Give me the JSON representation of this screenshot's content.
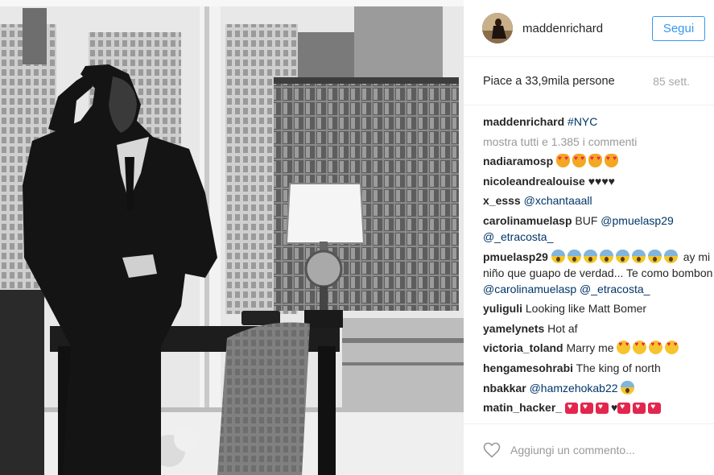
{
  "post": {
    "username": "maddenrichard",
    "follow_label": "Segui",
    "likes_text": "Piace a 33,9mila persone",
    "time_ago": "85 sett.",
    "caption": {
      "user": "maddenrichard",
      "text": "#NYC"
    },
    "view_all_comments": "mostra tutti e 1.385 i commenti",
    "comment_placeholder": "Aggiungi un commento..."
  },
  "comments": [
    {
      "user": "nadiaramosp",
      "parts": [
        {
          "type": "emoji",
          "icon": "cat-heart-eyes-emoji"
        },
        {
          "type": "emoji",
          "icon": "cat-heart-eyes-emoji"
        },
        {
          "type": "emoji",
          "icon": "cat-heart-eyes-emoji"
        },
        {
          "type": "emoji",
          "icon": "cat-heart-eyes-emoji"
        }
      ]
    },
    {
      "user": "nicoleandrealouise",
      "parts": [
        {
          "type": "text",
          "value": "♥♥♥♥"
        }
      ]
    },
    {
      "user": "x_esss",
      "parts": [
        {
          "type": "mention",
          "value": "@xchantaaall"
        }
      ]
    },
    {
      "user": "carolinamuelasp",
      "parts": [
        {
          "type": "text",
          "value": "BUF "
        },
        {
          "type": "mention",
          "value": "@pmuelasp29"
        },
        {
          "type": "text",
          "value": " "
        },
        {
          "type": "mention",
          "value": "@_etracosta_"
        }
      ]
    },
    {
      "user": "pmuelasp29",
      "parts": [
        {
          "type": "emoji",
          "icon": "scream-emoji"
        },
        {
          "type": "emoji",
          "icon": "scream-emoji"
        },
        {
          "type": "emoji",
          "icon": "scream-emoji"
        },
        {
          "type": "emoji",
          "icon": "scream-emoji"
        },
        {
          "type": "emoji",
          "icon": "scream-emoji"
        },
        {
          "type": "emoji",
          "icon": "scream-emoji"
        },
        {
          "type": "emoji",
          "icon": "scream-emoji"
        },
        {
          "type": "emoji",
          "icon": "scream-emoji"
        },
        {
          "type": "text",
          "value": " ay mi niño que guapo de verdad... Te como bombon "
        },
        {
          "type": "mention",
          "value": "@carolinamuelasp"
        },
        {
          "type": "text",
          "value": " "
        },
        {
          "type": "mention",
          "value": "@_etracosta_"
        }
      ]
    },
    {
      "user": "yuliguli",
      "parts": [
        {
          "type": "text",
          "value": "Looking like Matt Bomer"
        }
      ]
    },
    {
      "user": "yamelynets",
      "parts": [
        {
          "type": "text",
          "value": "Hot af"
        }
      ]
    },
    {
      "user": "victoria_toland",
      "parts": [
        {
          "type": "text",
          "value": "Marry me "
        },
        {
          "type": "emoji",
          "icon": "heart-eyes-emoji"
        },
        {
          "type": "emoji",
          "icon": "heart-eyes-emoji"
        },
        {
          "type": "emoji",
          "icon": "heart-eyes-emoji"
        },
        {
          "type": "emoji",
          "icon": "heart-eyes-emoji"
        }
      ]
    },
    {
      "user": "hengamesohrabi",
      "parts": [
        {
          "type": "text",
          "value": "The king of north"
        }
      ]
    },
    {
      "user": "nbakkar",
      "parts": [
        {
          "type": "mention",
          "value": "@hamzehokab22"
        },
        {
          "type": "text",
          "value": " "
        },
        {
          "type": "emoji",
          "icon": "scream-emoji"
        }
      ]
    },
    {
      "user": "matin_hacker_",
      "parts": [
        {
          "type": "emoji",
          "icon": "love-letter-emoji"
        },
        {
          "type": "emoji",
          "icon": "love-letter-emoji"
        },
        {
          "type": "emoji",
          "icon": "love-letter-emoji"
        },
        {
          "type": "text",
          "value": "♥"
        },
        {
          "type": "emoji",
          "icon": "love-letter-emoji"
        },
        {
          "type": "emoji",
          "icon": "love-letter-emoji"
        },
        {
          "type": "emoji",
          "icon": "love-letter-emoji"
        }
      ]
    }
  ],
  "colors": {
    "follow_blue": "#3897f0",
    "mention": "#003569",
    "muted": "#999999",
    "border": "#efefef"
  },
  "icons": {
    "like": "heart-outline-icon"
  }
}
